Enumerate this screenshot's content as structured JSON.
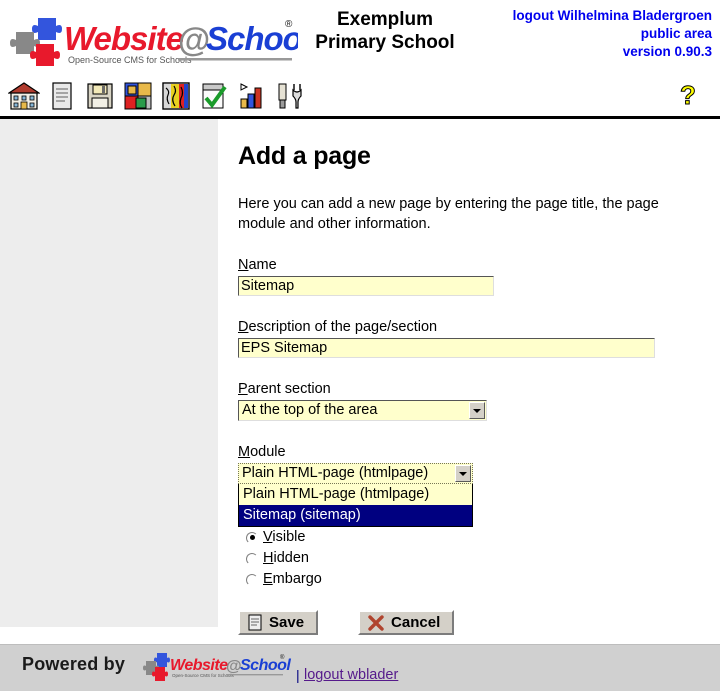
{
  "header": {
    "logo_alt": "Website@School",
    "logo_tagline": "Open-Source CMS for Schools",
    "logo_reg": "®",
    "school_name_line1": "Exemplum",
    "school_name_line2": "Primary School",
    "logout_user": "logout Wilhelmina Bladergroen",
    "area": "public area",
    "version": "version 0.90.3"
  },
  "toolbar": {
    "icons": [
      {
        "name": "home-icon",
        "title": "Home"
      },
      {
        "name": "page-icon",
        "title": "Pages"
      },
      {
        "name": "save-disk-icon",
        "title": "File manager"
      },
      {
        "name": "modules-icon",
        "title": "Modules"
      },
      {
        "name": "areas-icon",
        "title": "Areas"
      },
      {
        "name": "checklist-icon",
        "title": "Account"
      },
      {
        "name": "statistics-icon",
        "title": "Statistics"
      },
      {
        "name": "tools-icon",
        "title": "Tools"
      }
    ],
    "help_label": "?"
  },
  "page": {
    "title": "Add a page",
    "intro": "Here you can add a new page by entering the page title, the page module and other information."
  },
  "form": {
    "name": {
      "label_accesskey": "N",
      "label_rest": "ame",
      "value": "Sitemap",
      "placeholder": ""
    },
    "description": {
      "label_accesskey": "D",
      "label_rest": "escription of the page/section",
      "value": "EPS Sitemap",
      "placeholder": ""
    },
    "parent_section": {
      "label_accesskey": "P",
      "label_rest": "arent section",
      "selected": "At the top of the area",
      "options": [
        "At the top of the area"
      ]
    },
    "module": {
      "label_accesskey": "M",
      "label_rest": "odule",
      "selected": "Plain HTML-page (htmlpage)",
      "open": true,
      "options": [
        {
          "label": "Plain HTML-page (htmlpage)",
          "selected": false
        },
        {
          "label": "Sitemap (sitemap)",
          "selected": true
        }
      ]
    },
    "visibility": {
      "options": [
        {
          "accesskey": "V",
          "rest": "isible",
          "checked": true
        },
        {
          "accesskey": "H",
          "rest": "idden",
          "checked": false
        },
        {
          "accesskey": "E",
          "rest": "mbargo",
          "checked": false
        }
      ]
    },
    "save_label": "Save",
    "cancel_label": "Cancel"
  },
  "footer": {
    "powered_by": "Powered by",
    "logo_alt": "Website@School",
    "separator": "|",
    "logout_link": "logout wblader"
  },
  "colors": {
    "field_bg": "#ffffcc",
    "selected_bg": "#000080",
    "link_blue": "#0000ee",
    "footer_bg": "#d0d0d0",
    "sidebar_bg": "#ededed",
    "logo_red": "#e8192c",
    "logo_blue": "#1a3fd4",
    "help_yellow": "#ffff00"
  }
}
